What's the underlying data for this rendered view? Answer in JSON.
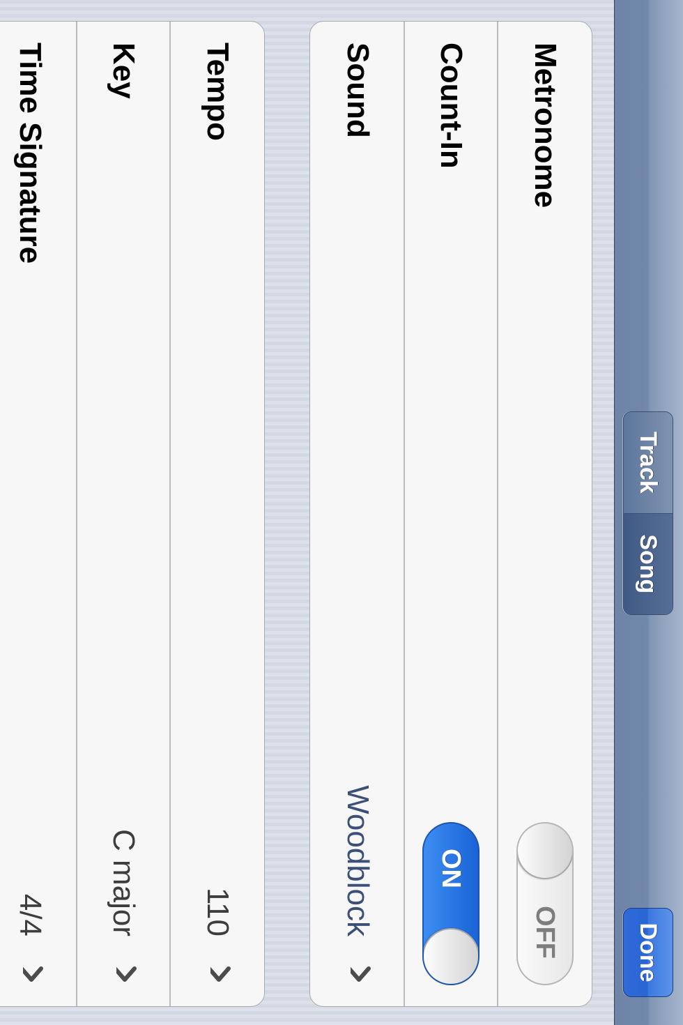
{
  "navbar": {
    "segments": [
      {
        "label": "Track",
        "active": false
      },
      {
        "label": "Song",
        "active": true
      }
    ],
    "done_label": "Done"
  },
  "metronome_group": {
    "metronome": {
      "label": "Metronome",
      "switch_text": "OFF",
      "state": "off"
    },
    "count_in": {
      "label": "Count-In",
      "switch_text": "ON",
      "state": "on"
    },
    "sound": {
      "label": "Sound",
      "value": "Woodblock"
    }
  },
  "song_group": {
    "tempo": {
      "label": "Tempo",
      "value": "110"
    },
    "key": {
      "label": "Key",
      "value": "C major"
    },
    "time_signature": {
      "label": "Time Signature",
      "value": "4/4"
    }
  },
  "colors": {
    "accent_blue": "#2f6bd8",
    "switch_on": "#3d8ef3",
    "value_blue": "#3b5078",
    "navbar": "#7289ab"
  },
  "icons": {
    "disclosure": "chevron-right-icon"
  }
}
